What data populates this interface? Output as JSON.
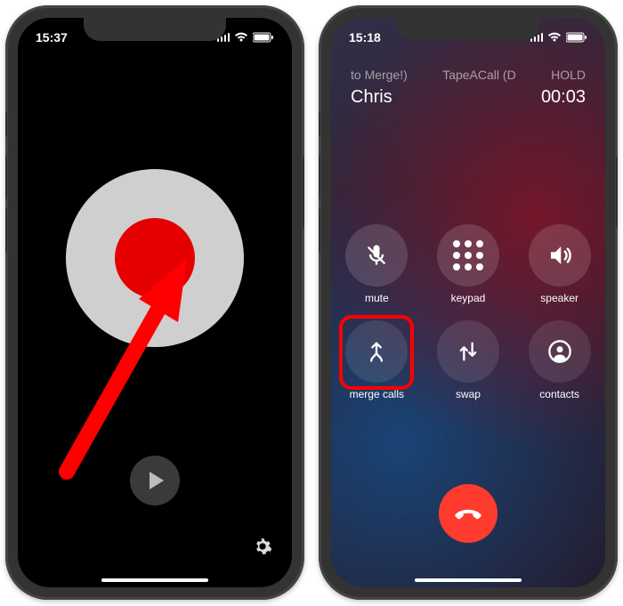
{
  "left": {
    "time": "15:37",
    "record_button_name": "record-button",
    "play_button_name": "play-button",
    "settings_icon_name": "gear-icon"
  },
  "right": {
    "time": "15:18",
    "header": {
      "line1_left": "to Merge!)",
      "line1_mid": "TapeACall (D",
      "line1_right": "HOLD",
      "caller": "Chris",
      "duration": "00:03"
    },
    "buttons": {
      "mute": "mute",
      "keypad": "keypad",
      "speaker": "speaker",
      "merge": "merge calls",
      "swap": "swap",
      "contacts": "contacts"
    }
  }
}
